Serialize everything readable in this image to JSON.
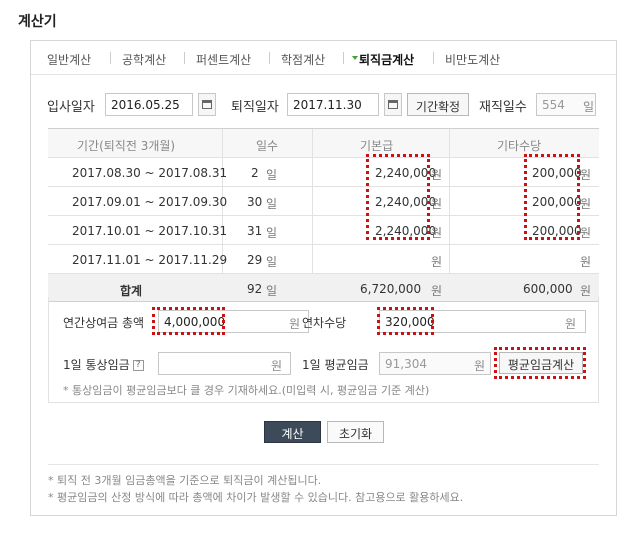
{
  "title": "계산기",
  "tabs": [
    "일반계산",
    "공학계산",
    "퍼센트계산",
    "학점계산",
    "퇴직금계산",
    "비만도계산"
  ],
  "dates": {
    "join_label": "입사일자",
    "join_value": "2016.05.25",
    "leave_label": "퇴직일자",
    "leave_value": "2017.11.30",
    "confirm_btn": "기간확정",
    "days_label": "재직일수",
    "days_value": "554",
    "days_unit": "일"
  },
  "table": {
    "headers": [
      "기간(퇴직전 3개월)",
      "일수",
      "기본급",
      "기타수당"
    ],
    "rows": [
      {
        "period": "2017.08.30 ~ 2017.08.31",
        "days": "2",
        "base": "2,240,000",
        "extra": "200,000"
      },
      {
        "period": "2017.09.01 ~ 2017.09.30",
        "days": "30",
        "base": "2,240,000",
        "extra": "200,000"
      },
      {
        "period": "2017.10.01 ~ 2017.10.31",
        "days": "31",
        "base": "2,240,000",
        "extra": "200,000"
      },
      {
        "period": "2017.11.01 ~ 2017.11.29",
        "days": "29",
        "base": "",
        "extra": ""
      }
    ],
    "total": {
      "label": "합계",
      "days": "92",
      "base": "6,720,000",
      "extra": "600,000"
    },
    "day_unit": "일",
    "won_unit": "원"
  },
  "bonus": {
    "annual_label": "연간상여금 총액",
    "annual_value": "4,000,000",
    "leave_label": "연차수당",
    "leave_value": "320,000",
    "daily_label": "1일 통상임금",
    "daily_value": "",
    "avg_label": "1일 평균임금",
    "avg_value": "91,304",
    "avg_btn": "평균임금계산",
    "help": "?",
    "note": "* 통상임금이 평균임금보다 클 경우 기재하세요.(미입력 시, 평균임금 기준 계산)",
    "won": "원"
  },
  "actions": {
    "calc": "계산",
    "reset": "초기화"
  },
  "footnotes": [
    "* 퇴직 전 3개월 임금총액을 기준으로 퇴직금이 계산됩니다.",
    "* 평균임금의 산정 방식에 따라 총액에 차이가 발생할 수 있습니다. 참고용으로 활용하세요."
  ]
}
